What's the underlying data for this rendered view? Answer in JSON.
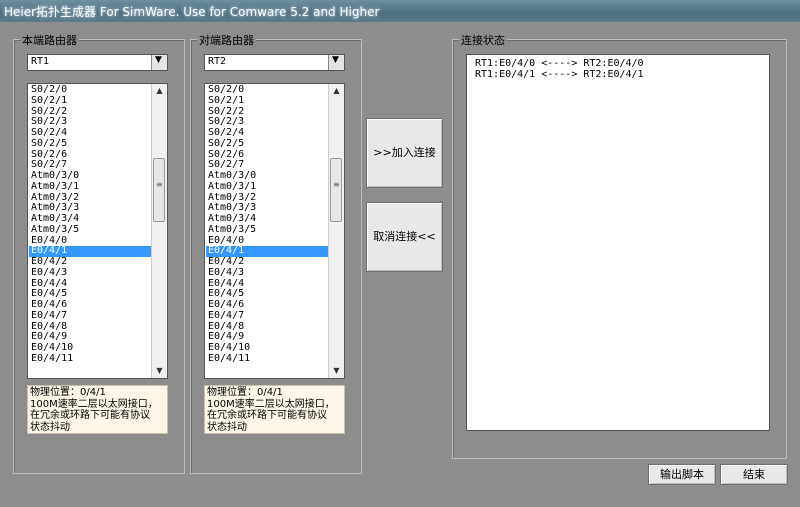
{
  "window": {
    "title": "Heier拓扑生成器 For SimWare. Use for Comware 5.2 and Higher"
  },
  "local_router": {
    "group_title": "本端路由器",
    "selected_router": "RT1",
    "interfaces": [
      "S0/2/0",
      "S0/2/1",
      "S0/2/2",
      "S0/2/3",
      "S0/2/4",
      "S0/2/5",
      "S0/2/6",
      "S0/2/7",
      "Atm0/3/0",
      "Atm0/3/1",
      "Atm0/3/2",
      "Atm0/3/3",
      "Atm0/3/4",
      "Atm0/3/5",
      "E0/4/0",
      "E0/4/1",
      "E0/4/2",
      "E0/4/3",
      "E0/4/4",
      "E0/4/5",
      "E0/4/6",
      "E0/4/7",
      "E0/4/8",
      "E0/4/9",
      "E0/4/10",
      "E0/4/11"
    ],
    "selected_interface": "E0/4/1",
    "info_lines": [
      "物理位置：0/4/1",
      "100M速率二层以太网接口，",
      "在冗余或环路下可能有协议",
      "状态抖动"
    ]
  },
  "peer_router": {
    "group_title": "对端路由器",
    "selected_router": "RT2",
    "interfaces": [
      "S0/2/0",
      "S0/2/1",
      "S0/2/2",
      "S0/2/3",
      "S0/2/4",
      "S0/2/5",
      "S0/2/6",
      "S0/2/7",
      "Atm0/3/0",
      "Atm0/3/1",
      "Atm0/3/2",
      "Atm0/3/3",
      "Atm0/3/4",
      "Atm0/3/5",
      "E0/4/0",
      "E0/4/1",
      "E0/4/2",
      "E0/4/3",
      "E0/4/4",
      "E0/4/5",
      "E0/4/6",
      "E0/4/7",
      "E0/4/8",
      "E0/4/9",
      "E0/4/10",
      "E0/4/11"
    ],
    "selected_interface": "E0/4/1",
    "info_lines": [
      "物理位置：0/4/1",
      "100M速率二层以太网接口，",
      "在冗余或环路下可能有协议",
      "状态抖动"
    ]
  },
  "actions": {
    "add_label": ">>加入连接",
    "remove_label": "取消连接<<",
    "export_label": "输出脚本",
    "close_label": "结束"
  },
  "status": {
    "group_title": "连接状态",
    "lines": [
      "RT1:E0/4/0 <----> RT2:E0/4/0",
      "RT1:E0/4/1 <----> RT2:E0/4/1"
    ]
  },
  "icons": {
    "dropdown": "chevron-down-icon",
    "scroll_up": "arrow-up-icon",
    "scroll_down": "arrow-down-icon"
  }
}
